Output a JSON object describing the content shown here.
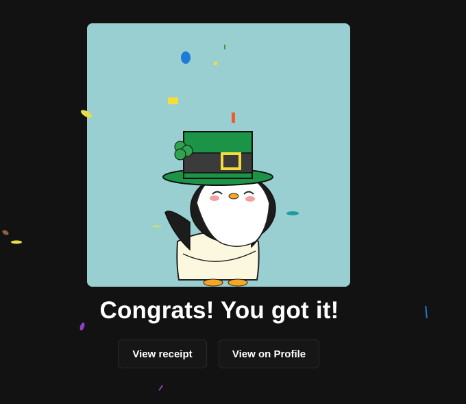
{
  "dialog": {
    "headline": "Congrats! You got it!",
    "buttons": {
      "receipt": "View receipt",
      "profile": "View on Profile"
    }
  },
  "nft": {
    "image_icon": "penguin-leprechaun-hat-icon",
    "background_color": "#99cfd1"
  },
  "colors": {
    "page_bg": "#121212",
    "button_bg": "#161616",
    "text": "#ffffff"
  }
}
